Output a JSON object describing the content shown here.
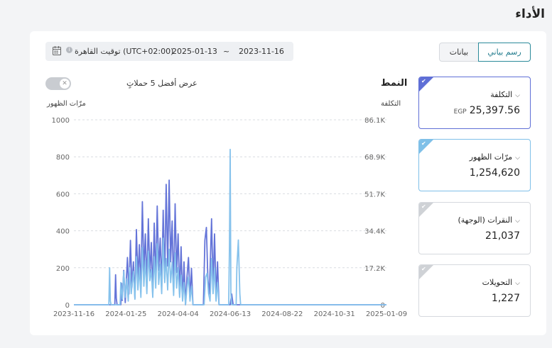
{
  "page": {
    "title": "الأداء"
  },
  "view_toggle": {
    "chart_label": "رسم بياني",
    "data_label": "بيانات",
    "selected": "chart"
  },
  "date_range": {
    "start": "2023-11-16",
    "separator": "~",
    "end": "2025-01-13",
    "timezone": "توقيت القاهرة (UTC+02:00)"
  },
  "pattern": {
    "title": "النمط"
  },
  "top5_toggle": {
    "label": "عرض أفضل 5 حملاتٍ",
    "enabled": false,
    "knob_symbol": "✕"
  },
  "metrics": [
    {
      "label": "التكلفة",
      "unit": "EGP",
      "value": "25,397.56",
      "selected": true,
      "color": "#5f6fd6"
    },
    {
      "label": "مرّات الظهور",
      "unit": "",
      "value": "1,254,620",
      "selected": true,
      "color": "#7fc0e8"
    },
    {
      "label": "النقرات (الوجهة)",
      "unit": "",
      "value": "21,037",
      "selected": false,
      "color": "#cfd2d6"
    },
    {
      "label": "التحويلات",
      "unit": "",
      "value": "1,227",
      "selected": false,
      "color": "#cfd2d6"
    }
  ],
  "icons": {
    "calendar": "calendar-icon",
    "info": "info-icon",
    "chevron": "chevron-down-icon",
    "check": "check-icon"
  },
  "chart_data": {
    "type": "line",
    "left_axis_title": "مرّات الظهور",
    "right_axis_title": "التكلفة",
    "left_ylim": [
      0,
      1000
    ],
    "left_ticks": [
      "0",
      "200",
      "400",
      "600",
      "800",
      "1000"
    ],
    "right_ylim": [
      0,
      86100
    ],
    "right_ticks": [
      "0",
      "17.2K",
      "34.4K",
      "51.7K",
      "68.9K",
      "86.1K"
    ],
    "x_ticks": [
      "2023-11-16",
      "2024-01-25",
      "2024-04-04",
      "2024-06-13",
      "2024-08-22",
      "2024-10-31",
      "2025-01-09"
    ],
    "x_domain": [
      "2023-11-16",
      "2025-01-09"
    ],
    "grid": true,
    "series": [
      {
        "name": "التكلفة",
        "axis": "right",
        "color": "#6474d8",
        "points": [
          [
            "2023-11-16",
            0
          ],
          [
            "2024-01-10",
            0
          ],
          [
            "2024-01-11",
            14000
          ],
          [
            "2024-01-12",
            3000
          ],
          [
            "2024-01-13",
            0
          ],
          [
            "2024-01-18",
            0
          ],
          [
            "2024-01-19",
            10000
          ],
          [
            "2024-01-20",
            2000
          ],
          [
            "2024-01-22",
            16000
          ],
          [
            "2024-01-24",
            1000
          ],
          [
            "2024-01-27",
            22000
          ],
          [
            "2024-01-29",
            5000
          ],
          [
            "2024-01-31",
            30000
          ],
          [
            "2024-02-02",
            8000
          ],
          [
            "2024-02-04",
            20000
          ],
          [
            "2024-02-06",
            3000
          ],
          [
            "2024-02-08",
            35000
          ],
          [
            "2024-02-10",
            12000
          ],
          [
            "2024-02-12",
            28000
          ],
          [
            "2024-02-14",
            6000
          ],
          [
            "2024-02-16",
            48000
          ],
          [
            "2024-02-18",
            15000
          ],
          [
            "2024-02-20",
            33000
          ],
          [
            "2024-02-22",
            9000
          ],
          [
            "2024-02-24",
            40000
          ],
          [
            "2024-02-26",
            14000
          ],
          [
            "2024-02-28",
            29000
          ],
          [
            "2024-03-01",
            4000
          ],
          [
            "2024-03-03",
            38000
          ],
          [
            "2024-03-05",
            10000
          ],
          [
            "2024-03-07",
            46000
          ],
          [
            "2024-03-09",
            16000
          ],
          [
            "2024-03-11",
            31000
          ],
          [
            "2024-03-13",
            8000
          ],
          [
            "2024-03-15",
            44000
          ],
          [
            "2024-03-17",
            12000
          ],
          [
            "2024-03-19",
            56000
          ],
          [
            "2024-03-21",
            18000
          ],
          [
            "2024-03-23",
            58000
          ],
          [
            "2024-03-25",
            20000
          ],
          [
            "2024-03-27",
            39000
          ],
          [
            "2024-03-29",
            6000
          ],
          [
            "2024-03-31",
            47000
          ],
          [
            "2024-04-02",
            15000
          ],
          [
            "2024-04-04",
            33000
          ],
          [
            "2024-04-06",
            5000
          ],
          [
            "2024-04-08",
            27000
          ],
          [
            "2024-04-10",
            2000
          ],
          [
            "2024-04-12",
            20000
          ],
          [
            "2024-04-14",
            0
          ],
          [
            "2024-04-16",
            13000
          ],
          [
            "2024-04-18",
            22000
          ],
          [
            "2024-04-20",
            3000
          ],
          [
            "2024-04-22",
            17000
          ],
          [
            "2024-04-24",
            0
          ],
          [
            "2024-05-08",
            0
          ],
          [
            "2024-05-10",
            30000
          ],
          [
            "2024-05-12",
            36000
          ],
          [
            "2024-05-14",
            12000
          ],
          [
            "2024-05-16",
            5000
          ],
          [
            "2024-05-19",
            40000
          ],
          [
            "2024-05-21",
            8000
          ],
          [
            "2024-05-23",
            33000
          ],
          [
            "2024-05-25",
            4000
          ],
          [
            "2024-05-27",
            20000
          ],
          [
            "2024-05-29",
            0
          ],
          [
            "2024-06-13",
            0
          ],
          [
            "2024-06-15",
            5000
          ],
          [
            "2024-06-17",
            0
          ],
          [
            "2025-01-09",
            0
          ]
        ]
      },
      {
        "name": "مرّات الظهور",
        "axis": "left",
        "color": "#86c2ec",
        "points": [
          [
            "2023-11-16",
            0
          ],
          [
            "2024-01-02",
            0
          ],
          [
            "2024-01-03",
            200
          ],
          [
            "2024-01-04",
            20
          ],
          [
            "2024-01-05",
            0
          ],
          [
            "2024-01-17",
            0
          ],
          [
            "2024-01-18",
            120
          ],
          [
            "2024-01-20",
            30
          ],
          [
            "2024-01-22",
            180
          ],
          [
            "2024-01-24",
            40
          ],
          [
            "2024-01-26",
            140
          ],
          [
            "2024-01-28",
            20
          ],
          [
            "2024-01-30",
            200
          ],
          [
            "2024-02-01",
            60
          ],
          [
            "2024-02-04",
            180
          ],
          [
            "2024-02-06",
            30
          ],
          [
            "2024-02-08",
            260
          ],
          [
            "2024-02-10",
            80
          ],
          [
            "2024-02-12",
            200
          ],
          [
            "2024-02-14",
            40
          ],
          [
            "2024-02-16",
            310
          ],
          [
            "2024-02-18",
            100
          ],
          [
            "2024-02-20",
            240
          ],
          [
            "2024-02-22",
            60
          ],
          [
            "2024-02-24",
            290
          ],
          [
            "2024-02-26",
            130
          ],
          [
            "2024-02-28",
            190
          ],
          [
            "2024-03-01",
            40
          ],
          [
            "2024-03-03",
            260
          ],
          [
            "2024-03-05",
            90
          ],
          [
            "2024-03-07",
            330
          ],
          [
            "2024-03-09",
            110
          ],
          [
            "2024-03-11",
            220
          ],
          [
            "2024-03-13",
            60
          ],
          [
            "2024-03-15",
            360
          ],
          [
            "2024-03-17",
            120
          ],
          [
            "2024-03-19",
            250
          ],
          [
            "2024-03-21",
            80
          ],
          [
            "2024-03-23",
            300
          ],
          [
            "2024-03-25",
            120
          ],
          [
            "2024-03-27",
            230
          ],
          [
            "2024-03-29",
            50
          ],
          [
            "2024-03-31",
            280
          ],
          [
            "2024-04-02",
            90
          ],
          [
            "2024-04-04",
            200
          ],
          [
            "2024-04-06",
            40
          ],
          [
            "2024-04-08",
            160
          ],
          [
            "2024-04-10",
            20
          ],
          [
            "2024-04-12",
            120
          ],
          [
            "2024-04-14",
            0
          ],
          [
            "2024-04-16",
            90
          ],
          [
            "2024-04-18",
            150
          ],
          [
            "2024-04-20",
            20
          ],
          [
            "2024-04-22",
            100
          ],
          [
            "2024-04-24",
            0
          ],
          [
            "2024-05-09",
            0
          ],
          [
            "2024-05-11",
            150
          ],
          [
            "2024-05-13",
            170
          ],
          [
            "2024-05-15",
            60
          ],
          [
            "2024-05-17",
            20
          ],
          [
            "2024-05-19",
            250
          ],
          [
            "2024-05-21",
            60
          ],
          [
            "2024-05-23",
            200
          ],
          [
            "2024-05-25",
            20
          ],
          [
            "2024-05-27",
            120
          ],
          [
            "2024-05-29",
            0
          ],
          [
            "2024-06-11",
            0
          ],
          [
            "2024-06-12",
            320
          ],
          [
            "2024-06-13",
            840
          ],
          [
            "2024-06-14",
            60
          ],
          [
            "2024-06-15",
            0
          ],
          [
            "2024-06-21",
            0
          ],
          [
            "2024-06-22",
            200
          ],
          [
            "2024-06-24",
            350
          ],
          [
            "2024-06-26",
            60
          ],
          [
            "2024-06-27",
            0
          ],
          [
            "2025-01-09",
            0
          ]
        ]
      }
    ]
  }
}
